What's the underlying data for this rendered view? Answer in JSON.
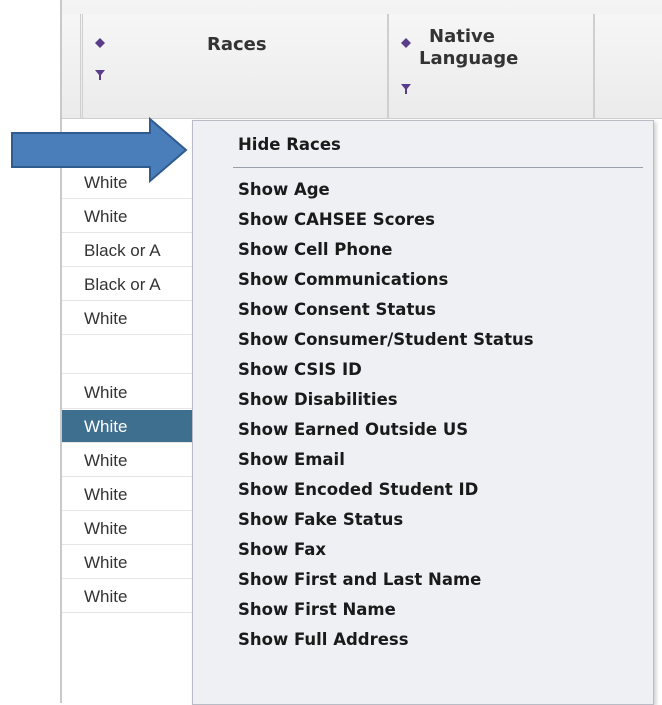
{
  "columns": {
    "races": "Races",
    "native_language_line1": "Native",
    "native_language_line2": "Language"
  },
  "rows": [
    "White",
    "White",
    "Black or A",
    "Black or A",
    "White",
    "",
    "White",
    "White",
    "White",
    "White",
    "White",
    "White",
    "White"
  ],
  "menu": {
    "hide": "Hide Races",
    "items": [
      "Show Age",
      "Show CAHSEE Scores",
      "Show Cell Phone",
      "Show Communications",
      "Show Consent Status",
      "Show Consumer/Student Status",
      "Show CSIS ID",
      "Show Disabilities",
      "Show Earned Outside US",
      "Show Email",
      "Show Encoded Student ID",
      "Show Fake Status",
      "Show Fax",
      "Show First and Last Name",
      "Show First Name",
      "Show Full Address"
    ]
  },
  "colors": {
    "selected_row": "#3f6f8f",
    "arrow_fill": "#4a7ebb",
    "arrow_stroke": "#2f5b8f",
    "icon_purple": "#5a3d8a"
  },
  "icons": [
    "sort-icon",
    "filter-icon",
    "arrow-pointer-icon"
  ]
}
